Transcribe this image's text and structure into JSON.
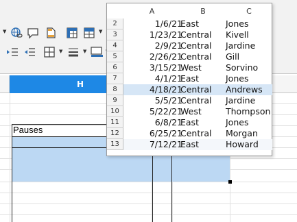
{
  "sheet": {
    "active_column": "H",
    "cell_label": "Pauses"
  },
  "popup": {
    "columns": [
      "A",
      "B",
      "C"
    ],
    "rows": [
      {
        "num": "2",
        "date": "1/6/21",
        "region": "East",
        "rep": "Jones"
      },
      {
        "num": "3",
        "date": "1/23/21",
        "region": "Central",
        "rep": "Kivell"
      },
      {
        "num": "4",
        "date": "2/9/21",
        "region": "Central",
        "rep": "Jardine"
      },
      {
        "num": "5",
        "date": "2/26/21",
        "region": "Central",
        "rep": "Gill"
      },
      {
        "num": "6",
        "date": "3/15/21",
        "region": "West",
        "rep": "Sorvino"
      },
      {
        "num": "7",
        "date": "4/1/21",
        "region": "East",
        "rep": "Jones"
      },
      {
        "num": "8",
        "date": "4/18/21",
        "region": "Central",
        "rep": "Andrews"
      },
      {
        "num": "9",
        "date": "5/5/21",
        "region": "Central",
        "rep": "Jardine"
      },
      {
        "num": "10",
        "date": "5/22/21",
        "region": "West",
        "rep": "Thompson"
      },
      {
        "num": "11",
        "date": "6/8/21",
        "region": "East",
        "rep": "Jones"
      },
      {
        "num": "12",
        "date": "6/25/21",
        "region": "Central",
        "rep": "Morgan"
      },
      {
        "num": "13",
        "date": "7/12/21",
        "region": "East",
        "rep": "Howard"
      }
    ]
  },
  "toolbar": {
    "icons": [
      "insert-hyperlink-icon",
      "insert-comment-icon",
      "headers-footers-icon",
      "pivot-table-icon",
      "freeze-rows-icon",
      "indent-increase-icon",
      "indent-decrease-icon",
      "borders-icon",
      "border-style-icon",
      "border-color-icon"
    ]
  },
  "colors": {
    "accent": "#1e88e5",
    "selection": "#bcd8f3",
    "popup_highlight": "#d6e6f6"
  }
}
